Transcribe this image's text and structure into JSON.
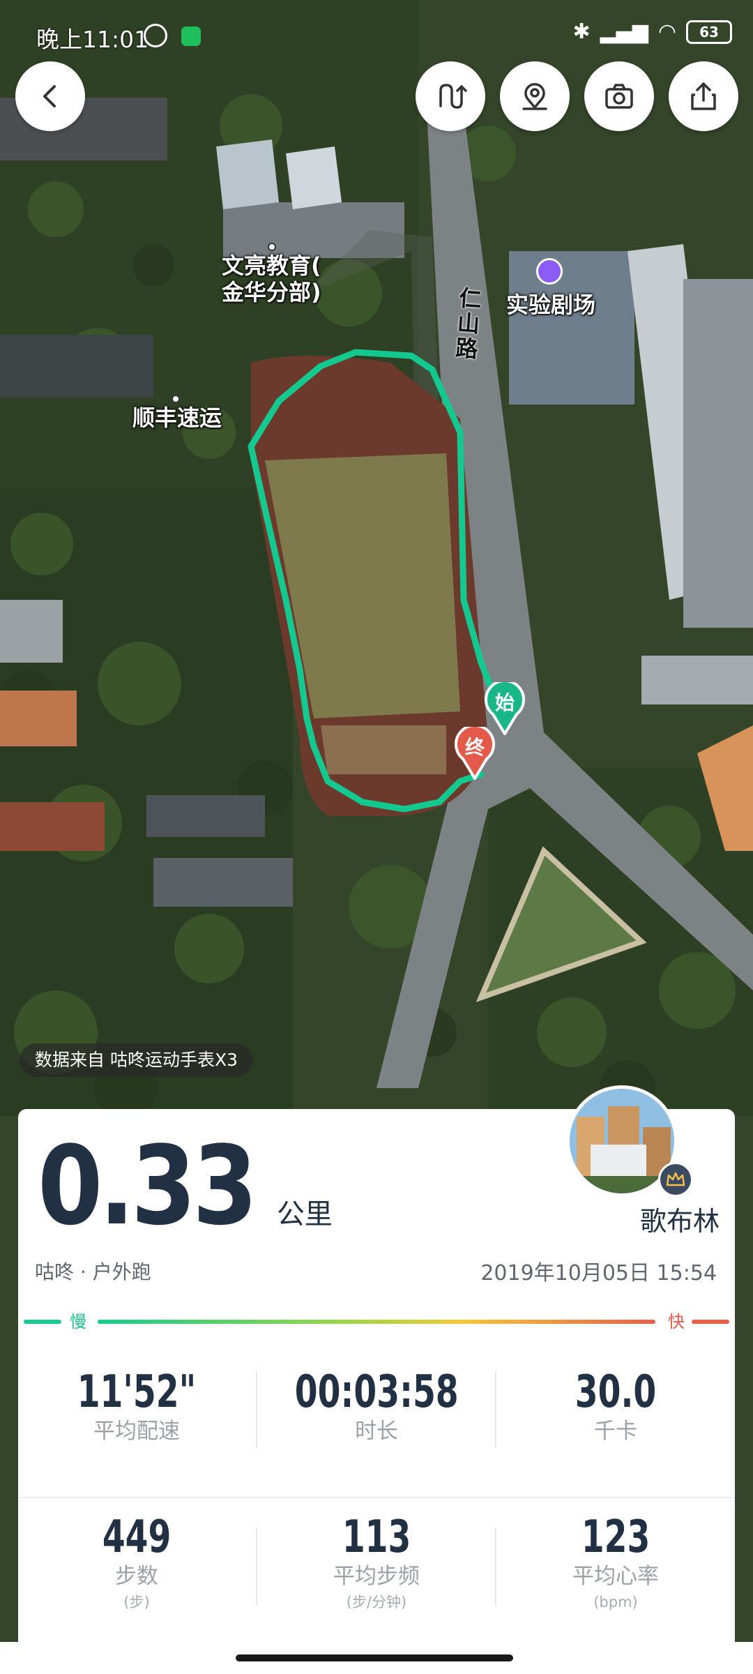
{
  "status_bar": {
    "time": "晚上11:01",
    "battery": "63"
  },
  "map": {
    "labels": {
      "wenliang": "文亮教育(\n金华分部)",
      "theater": "实验剧场",
      "shunfeng": "顺丰速运",
      "road": "仁山路"
    },
    "start_marker": "始",
    "end_marker": "终",
    "route_color": "#14c990"
  },
  "data_source": "数据来自 咕咚运动手表X3",
  "summary": {
    "distance": "0.33",
    "distance_unit": "公里",
    "activity_type": "咕咚 · 户外跑",
    "date": "2019年10月05日 15:54",
    "user_name": "歌布林"
  },
  "pace_scale": {
    "slow": "慢",
    "fast": "快"
  },
  "stats_row1": [
    {
      "value": "11'52\"",
      "label": "平均配速"
    },
    {
      "value": "00:03:58",
      "label": "时长"
    },
    {
      "value": "30.0",
      "label": "千卡"
    }
  ],
  "stats_row2": [
    {
      "value": "449",
      "label": "步数",
      "unit": "(步)"
    },
    {
      "value": "113",
      "label": "平均步频",
      "unit": "(步/分钟)"
    },
    {
      "value": "123",
      "label": "平均心率",
      "unit": "(bpm)"
    }
  ]
}
